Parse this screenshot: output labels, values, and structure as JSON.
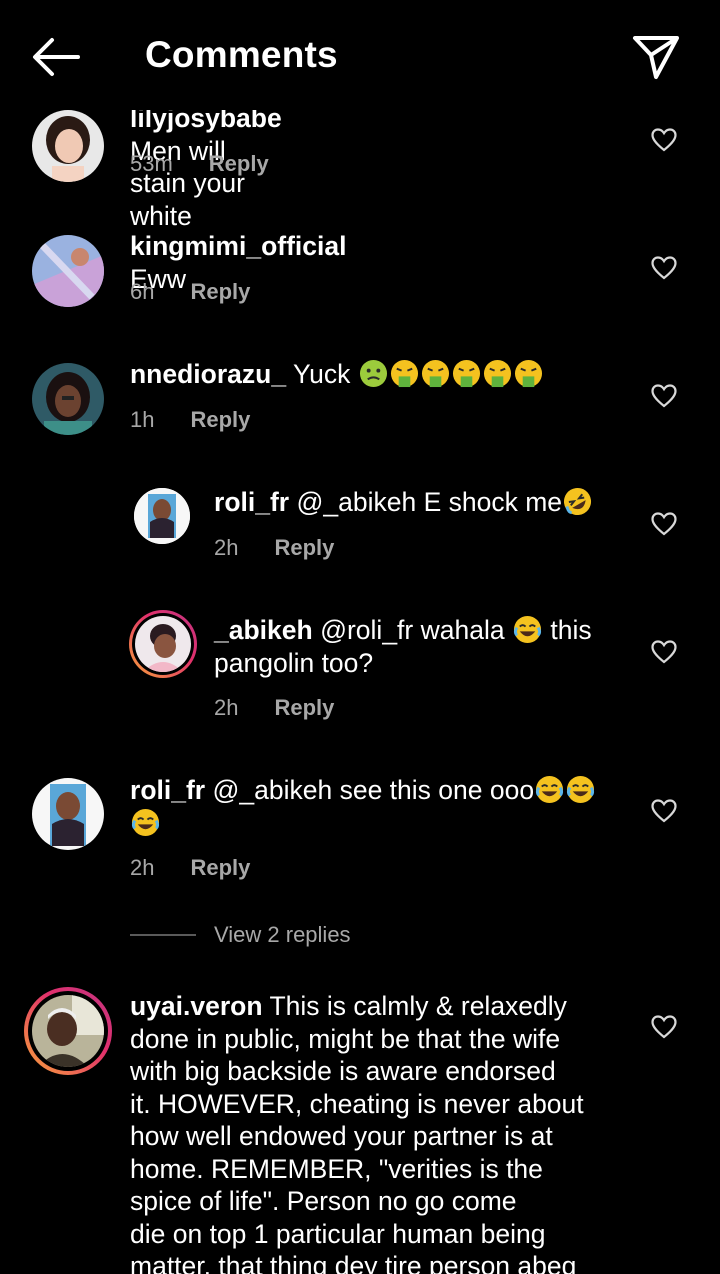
{
  "header": {
    "title": "Comments"
  },
  "comments": [
    {
      "username": "lilyjosybabe",
      "text": "Men will stain your white",
      "time": "53m",
      "reply": "Reply",
      "emojis": []
    },
    {
      "username": "kingmimi_official",
      "text": "Eww",
      "time": "6h",
      "reply": "Reply",
      "emojis": []
    },
    {
      "username": "nnediorazu_",
      "text": "Yuck",
      "time": "1h",
      "reply": "Reply",
      "emojis": [
        "nauseated-face",
        "vomiting-face",
        "vomiting-face",
        "vomiting-face",
        "vomiting-face",
        "vomiting-face"
      ]
    },
    {
      "username": "roli_fr",
      "text": "@_abikeh E shock me",
      "time": "2h",
      "reply": "Reply",
      "emojis": [
        "rolling-laughing-face"
      ]
    },
    {
      "username": "_abikeh",
      "text_line1": "@roli_fr wahala",
      "text_line1b": "this",
      "text_line2": "pangolin too?",
      "time": "2h",
      "reply": "Reply",
      "emojis": [
        "tears-of-joy-face"
      ]
    },
    {
      "username": "roli_fr",
      "text": "@_abikeh see this one ooo",
      "time": "2h",
      "reply": "Reply",
      "emojis": [
        "tears-of-joy-face",
        "tears-of-joy-face",
        "tears-of-joy-face"
      ]
    },
    {
      "username": "uyai.veron",
      "lines": [
        "This is calmly & relaxedly",
        "done in public, might be that the wife",
        "with big backside is aware endorsed",
        "it. HOWEVER, cheating is never about",
        "how well endowed your partner is at",
        "home. REMEMBER, \"verities is the",
        "spice of life\". Person no go come",
        "die on top 1 particular human being",
        "matter, that thing dey tire person abeg"
      ]
    }
  ],
  "view_replies": "View 2 replies",
  "colors": {
    "background": "#000000",
    "text": "#ffffff",
    "meta": "#a8a8a8",
    "story_ring": "#e1306c"
  }
}
